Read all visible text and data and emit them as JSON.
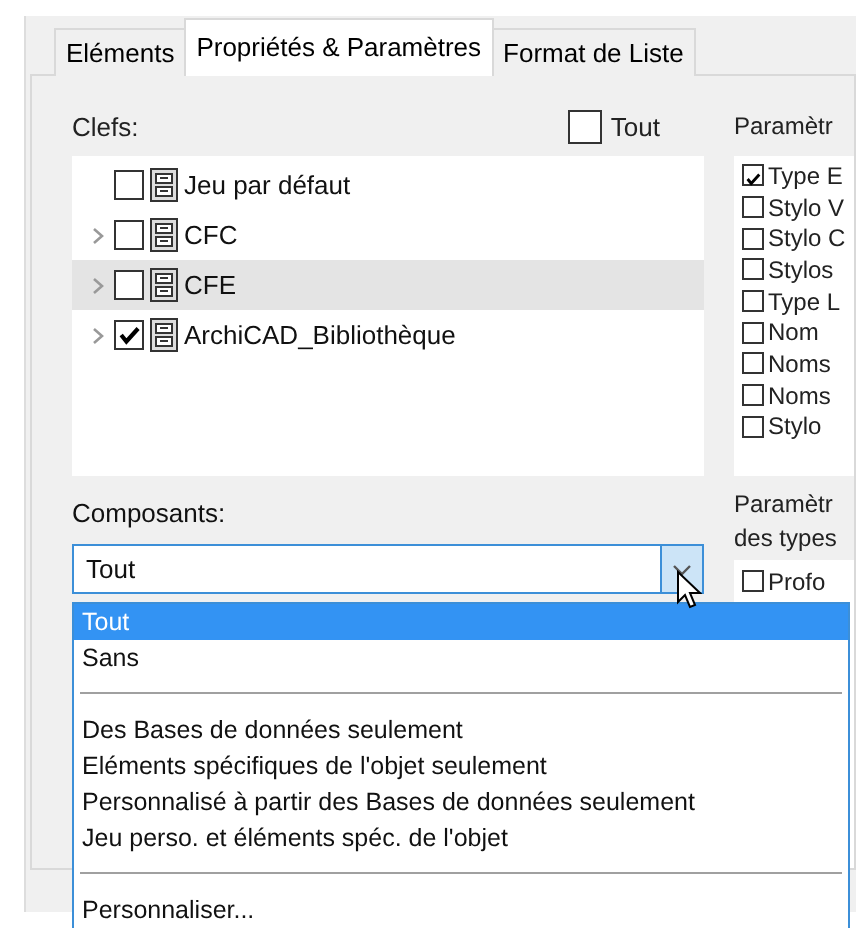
{
  "tabs": [
    {
      "label": "Eléments",
      "selected": false
    },
    {
      "label": "Propriétés & Paramètres",
      "selected": true
    },
    {
      "label": "Format de Liste",
      "selected": false
    }
  ],
  "keys": {
    "label": "Clefs:",
    "all_checkbox": {
      "label": "Tout",
      "checked": false
    },
    "items": [
      {
        "label": "Jeu par défaut",
        "checked": false,
        "expandable": false,
        "selected": false
      },
      {
        "label": "CFC",
        "checked": false,
        "expandable": true,
        "selected": false
      },
      {
        "label": "CFE",
        "checked": false,
        "expandable": true,
        "selected": true
      },
      {
        "label": "ArchiCAD_Bibliothèque",
        "checked": true,
        "expandable": true,
        "selected": false
      }
    ]
  },
  "parameters": {
    "label": "Paramètr",
    "items": [
      {
        "label": "Type E",
        "checked": true
      },
      {
        "label": "Stylo V",
        "checked": false
      },
      {
        "label": "Stylo C",
        "checked": false
      },
      {
        "label": "Stylos",
        "checked": false
      },
      {
        "label": "Type L",
        "checked": false
      },
      {
        "label": "Nom",
        "checked": false
      },
      {
        "label": "Noms",
        "checked": false
      },
      {
        "label": "Noms",
        "checked": false
      },
      {
        "label": "Stylo",
        "checked": false
      }
    ]
  },
  "components": {
    "label": "Composants:",
    "value": "Tout",
    "expanded": true,
    "options": [
      {
        "kind": "option",
        "label": "Tout",
        "selected": true
      },
      {
        "kind": "option",
        "label": "Sans",
        "selected": false
      },
      {
        "kind": "separator"
      },
      {
        "kind": "option",
        "label": "Des Bases de données seulement",
        "selected": false
      },
      {
        "kind": "option",
        "label": "Eléments spécifiques de l'objet seulement",
        "selected": false
      },
      {
        "kind": "option",
        "label": "Personnalisé à partir des Bases de données seulement",
        "selected": false
      },
      {
        "kind": "option",
        "label": "Jeu perso. et éléments spéc. de l'objet",
        "selected": false
      },
      {
        "kind": "separator"
      },
      {
        "kind": "option",
        "label": "Personnaliser...",
        "selected": false
      }
    ]
  },
  "type_parameters": {
    "label_lines": [
      "Paramètr",
      "des types"
    ],
    "items": [
      {
        "label": "Profo",
        "checked": false
      }
    ]
  }
}
